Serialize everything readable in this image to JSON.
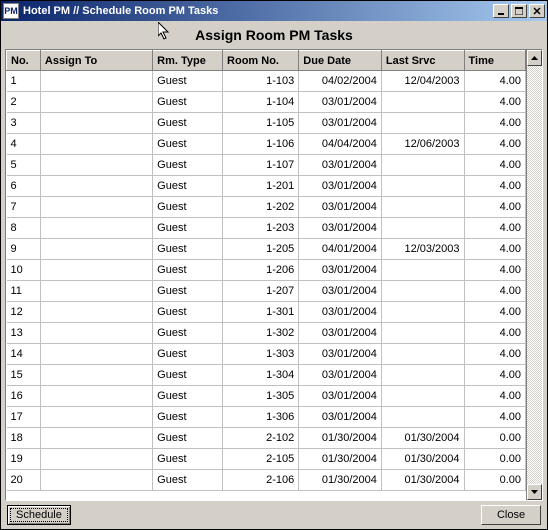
{
  "window": {
    "title": "Hotel PM // Schedule Room PM Tasks"
  },
  "heading": "Assign Room PM Tasks",
  "columns": {
    "no": "No.",
    "assign": "Assign To",
    "type": "Rm. Type",
    "room": "Room No.",
    "due": "Due Date",
    "last": "Last Srvc",
    "time": "Time"
  },
  "rows": [
    {
      "no": "1",
      "assign": "",
      "type": "Guest",
      "room": "1-103",
      "due": "04/02/2004",
      "last": "12/04/2003",
      "time": "4.00"
    },
    {
      "no": "2",
      "assign": "",
      "type": "Guest",
      "room": "1-104",
      "due": "03/01/2004",
      "last": "",
      "time": "4.00"
    },
    {
      "no": "3",
      "assign": "",
      "type": "Guest",
      "room": "1-105",
      "due": "03/01/2004",
      "last": "",
      "time": "4.00"
    },
    {
      "no": "4",
      "assign": "",
      "type": "Guest",
      "room": "1-106",
      "due": "04/04/2004",
      "last": "12/06/2003",
      "time": "4.00"
    },
    {
      "no": "5",
      "assign": "",
      "type": "Guest",
      "room": "1-107",
      "due": "03/01/2004",
      "last": "",
      "time": "4.00"
    },
    {
      "no": "6",
      "assign": "",
      "type": "Guest",
      "room": "1-201",
      "due": "03/01/2004",
      "last": "",
      "time": "4.00"
    },
    {
      "no": "7",
      "assign": "",
      "type": "Guest",
      "room": "1-202",
      "due": "03/01/2004",
      "last": "",
      "time": "4.00"
    },
    {
      "no": "8",
      "assign": "",
      "type": "Guest",
      "room": "1-203",
      "due": "03/01/2004",
      "last": "",
      "time": "4.00"
    },
    {
      "no": "9",
      "assign": "",
      "type": "Guest",
      "room": "1-205",
      "due": "04/01/2004",
      "last": "12/03/2003",
      "time": "4.00"
    },
    {
      "no": "10",
      "assign": "",
      "type": "Guest",
      "room": "1-206",
      "due": "03/01/2004",
      "last": "",
      "time": "4.00"
    },
    {
      "no": "11",
      "assign": "",
      "type": "Guest",
      "room": "1-207",
      "due": "03/01/2004",
      "last": "",
      "time": "4.00"
    },
    {
      "no": "12",
      "assign": "",
      "type": "Guest",
      "room": "1-301",
      "due": "03/01/2004",
      "last": "",
      "time": "4.00"
    },
    {
      "no": "13",
      "assign": "",
      "type": "Guest",
      "room": "1-302",
      "due": "03/01/2004",
      "last": "",
      "time": "4.00"
    },
    {
      "no": "14",
      "assign": "",
      "type": "Guest",
      "room": "1-303",
      "due": "03/01/2004",
      "last": "",
      "time": "4.00"
    },
    {
      "no": "15",
      "assign": "",
      "type": "Guest",
      "room": "1-304",
      "due": "03/01/2004",
      "last": "",
      "time": "4.00"
    },
    {
      "no": "16",
      "assign": "",
      "type": "Guest",
      "room": "1-305",
      "due": "03/01/2004",
      "last": "",
      "time": "4.00"
    },
    {
      "no": "17",
      "assign": "",
      "type": "Guest",
      "room": "1-306",
      "due": "03/01/2004",
      "last": "",
      "time": "4.00"
    },
    {
      "no": "18",
      "assign": "",
      "type": "Guest",
      "room": "2-102",
      "due": "01/30/2004",
      "last": "01/30/2004",
      "time": "0.00"
    },
    {
      "no": "19",
      "assign": "",
      "type": "Guest",
      "room": "2-105",
      "due": "01/30/2004",
      "last": "01/30/2004",
      "time": "0.00"
    },
    {
      "no": "20",
      "assign": "",
      "type": "Guest",
      "room": "2-106",
      "due": "01/30/2004",
      "last": "01/30/2004",
      "time": "0.00"
    }
  ],
  "buttons": {
    "schedule": "Schedule",
    "close": "Close"
  }
}
